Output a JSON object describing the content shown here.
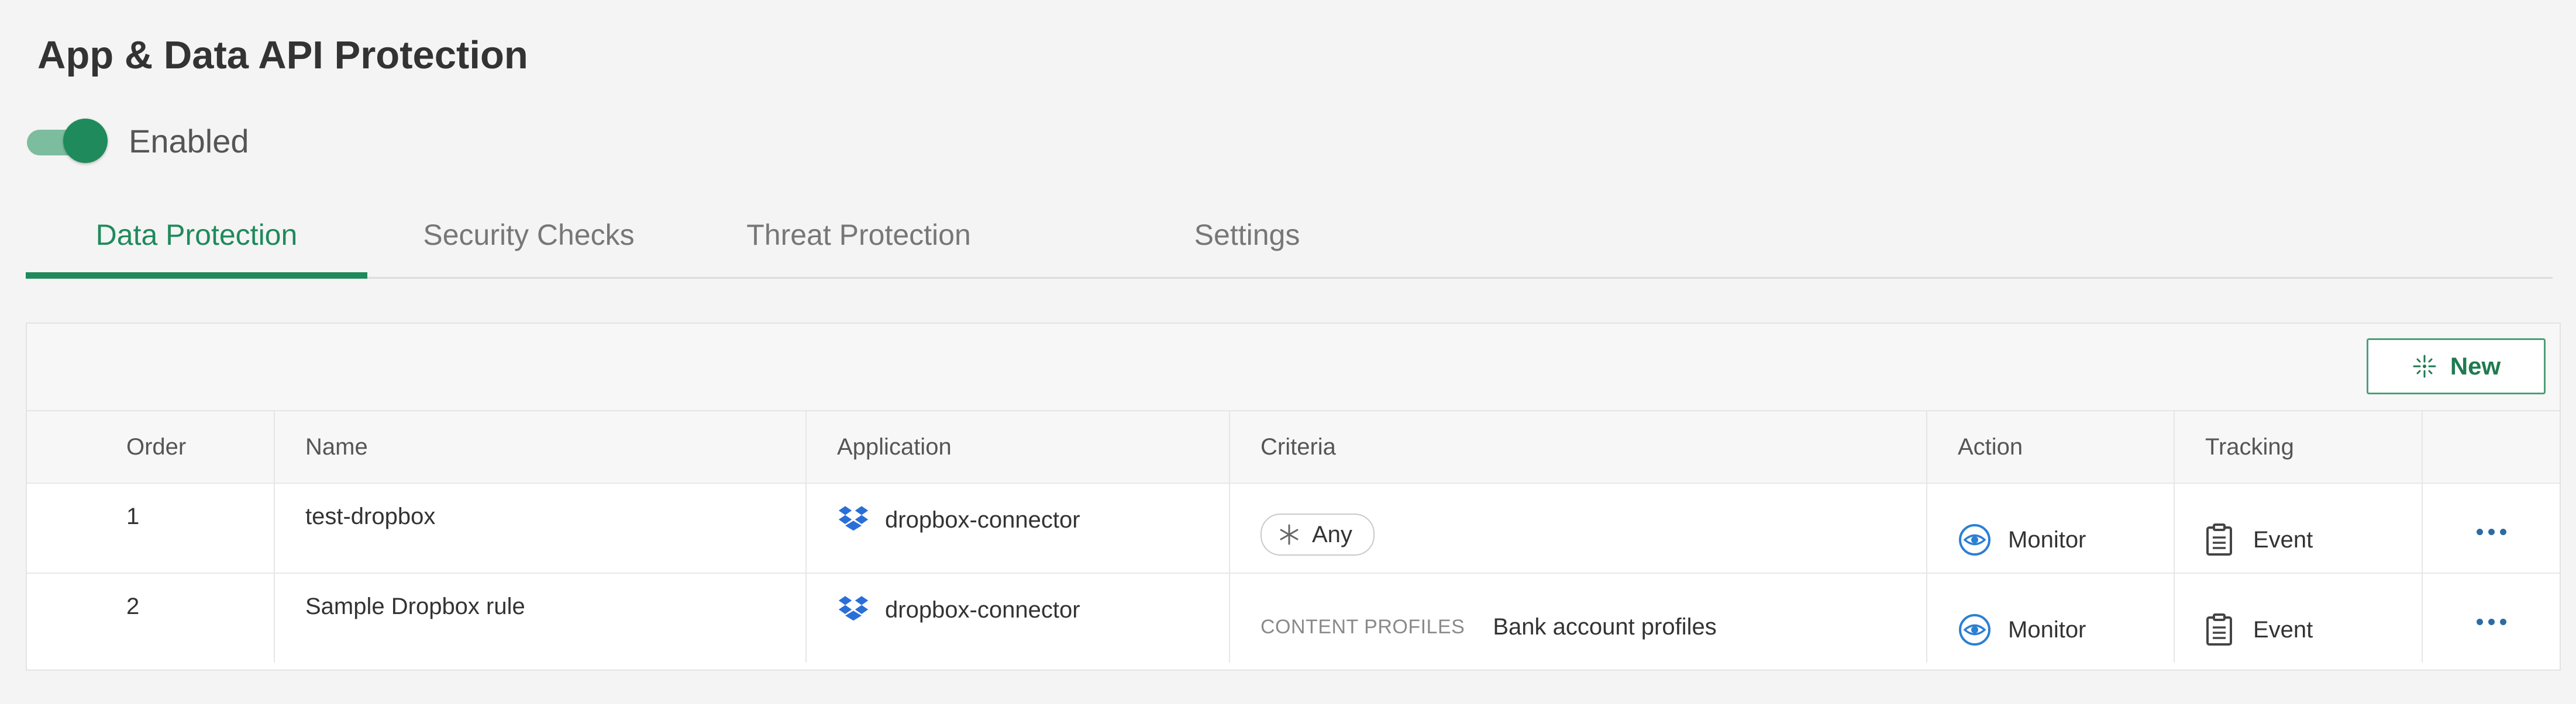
{
  "page": {
    "title": "App & Data API Protection"
  },
  "toggle": {
    "state": "on",
    "label": "Enabled"
  },
  "tabs": [
    {
      "label": "Data Protection",
      "active": true
    },
    {
      "label": "Security Checks",
      "active": false
    },
    {
      "label": "Threat Protection",
      "active": false
    },
    {
      "label": "Settings",
      "active": false
    }
  ],
  "toolbar": {
    "new_label": "New",
    "new_icon": "sparkle-icon"
  },
  "table": {
    "columns": [
      "Order",
      "Name",
      "Application",
      "Criteria",
      "Action",
      "Tracking",
      ""
    ],
    "rows": [
      {
        "order": "1",
        "name": "test-dropbox",
        "application": "dropbox-connector",
        "criteria_chip": "Any",
        "action": "Monitor",
        "tracking": "Event"
      },
      {
        "order": "2",
        "name": "Sample Dropbox rule",
        "application": "dropbox-connector",
        "criteria_label": "CONTENT PROFILES",
        "criteria_value": "Bank account profiles",
        "action": "Monitor",
        "tracking": "Event"
      }
    ]
  },
  "colors": {
    "accent": "#1f8a5b",
    "toggle_track": "#7dbd9f",
    "dropbox": "#2a6fd8",
    "eye": "#2b7fd4",
    "more_dots": "#2d6ca3"
  }
}
